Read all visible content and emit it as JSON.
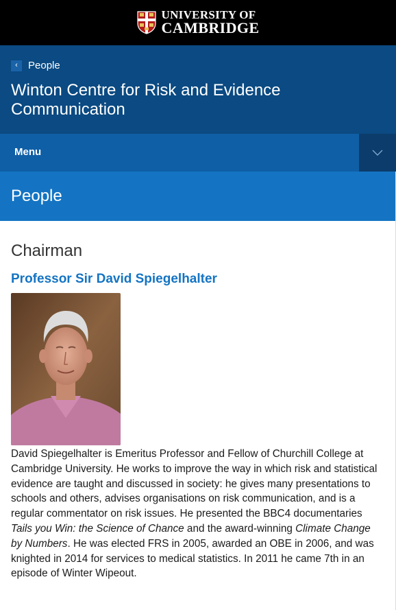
{
  "header": {
    "logo": {
      "line1": "UNIVERSITY OF",
      "line2": "CAMBRIDGE",
      "icon": "cambridge-crest"
    },
    "back_label": "People",
    "site_title": "Winton Centre for Risk and Evidence Communication"
  },
  "menu": {
    "label": "Menu",
    "toggle_icon": "chevron-down"
  },
  "page": {
    "title": "People"
  },
  "section": {
    "heading": "Chairman",
    "person": {
      "name": "Professor Sir David Spiegelhalter",
      "bio_part1": "David Spiegelhalter is Emeritus Professor and Fellow of Churchill College at Cambridge University. He works to improve the way in which risk and statistical evidence are taught and discussed in society: he gives many presentations to schools and others, advises organisations on risk communication, and is a regular commentator on risk issues. He presented the BBC4 documentaries ",
      "bio_italic1": "Tails you Win: the Science of Chance",
      "bio_part2": " and the award-winning ",
      "bio_italic2": "Climate Change by Numbers",
      "bio_part3": ". He was elected FRS in 2005, awarded an OBE in 2006, and was knighted in 2014 for services to medical statistics. In 2011 he came 7th in an episode of Winter Wipeout."
    }
  },
  "colors": {
    "topbar": "#000000",
    "header": "#0b4a82",
    "menubar": "#0f5fa6",
    "pagebar": "#1474c3",
    "link": "#1474c3"
  }
}
